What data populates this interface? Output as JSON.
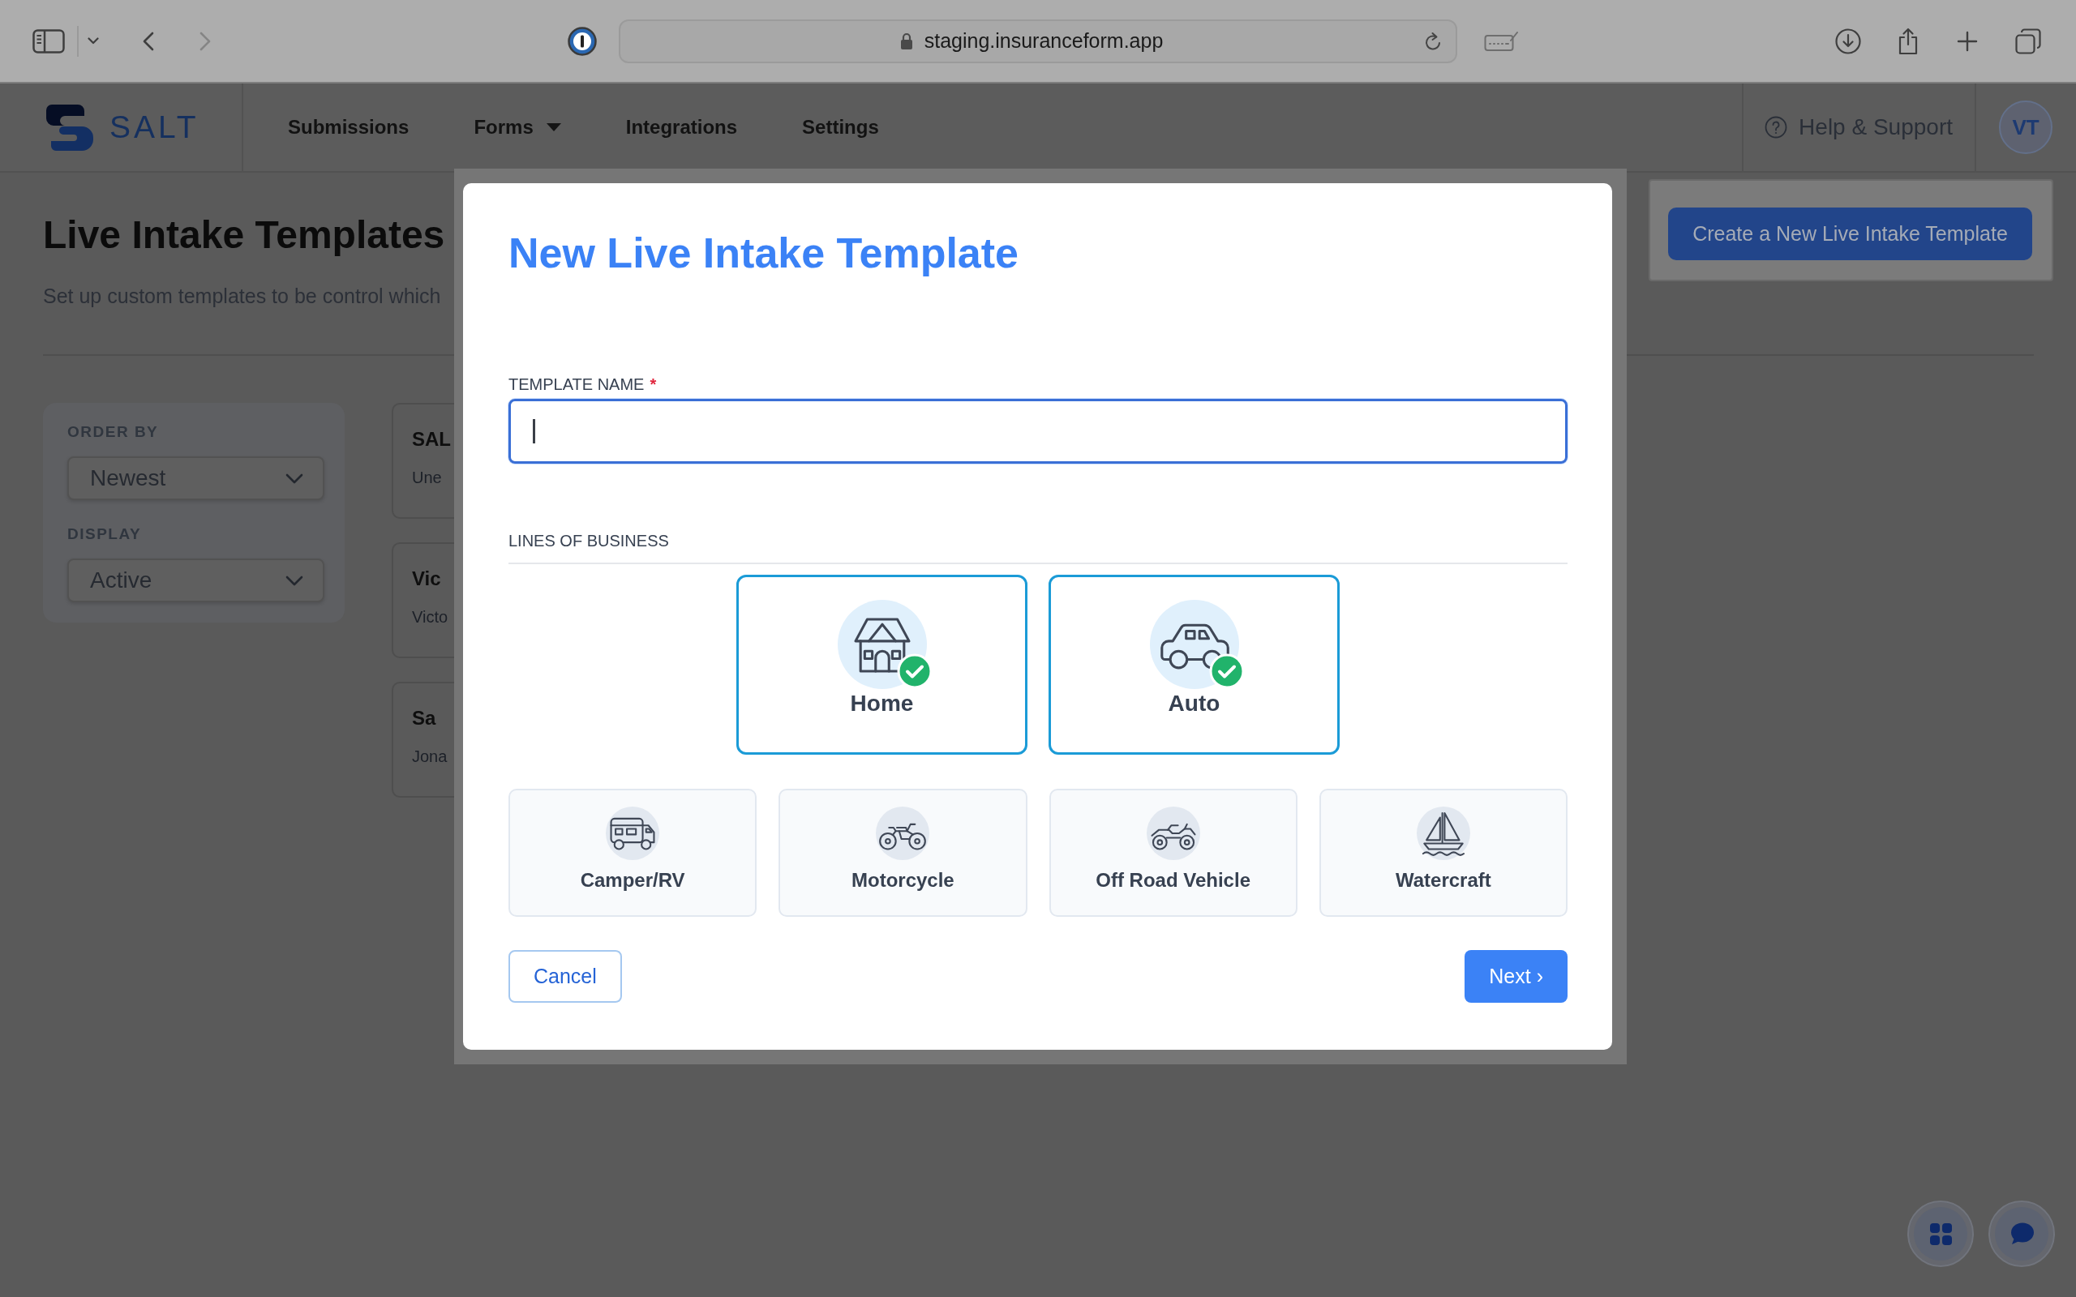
{
  "browser": {
    "url": "staging.insuranceform.app"
  },
  "header": {
    "logo": "SALT",
    "nav": [
      {
        "label": "Submissions",
        "dropdown": false
      },
      {
        "label": "Forms",
        "dropdown": true
      },
      {
        "label": "Integrations",
        "dropdown": false
      },
      {
        "label": "Settings",
        "dropdown": false
      }
    ],
    "help": "Help & Support",
    "avatar": "VT"
  },
  "page": {
    "title": "Live Intake Templates",
    "subtitle": "Set up custom templates to be control which",
    "create_button": "Create a New Live Intake Template"
  },
  "filters": [
    {
      "label": "ORDER BY",
      "value": "Newest"
    },
    {
      "label": "DISPLAY",
      "value": "Active"
    }
  ],
  "templates": [
    {
      "name": "SAL",
      "description": "Une"
    },
    {
      "name": "Vic",
      "description": "Victo"
    },
    {
      "name": "Sa",
      "description": "Jona"
    }
  ],
  "modal": {
    "title": "New Live Intake Template",
    "name_field": {
      "label": "TEMPLATE NAME",
      "required_mark": "*",
      "focused": true
    },
    "section_label": "LINES OF BUSINESS",
    "lines": [
      {
        "label": "Home",
        "kind": "home",
        "selected": true
      },
      {
        "label": "Auto",
        "kind": "auto",
        "selected": true
      },
      {
        "label": "Camper/RV",
        "kind": "camper",
        "selected": false
      },
      {
        "label": "Motorcycle",
        "kind": "motorcycle",
        "selected": false
      },
      {
        "label": "Off Road Vehicle",
        "kind": "off_road",
        "selected": false
      },
      {
        "label": "Watercraft",
        "kind": "watercraft",
        "selected": false
      }
    ],
    "actions": [
      {
        "label": "Cancel",
        "kind": "cancel"
      },
      {
        "label": "Next ›",
        "kind": "next"
      }
    ]
  }
}
